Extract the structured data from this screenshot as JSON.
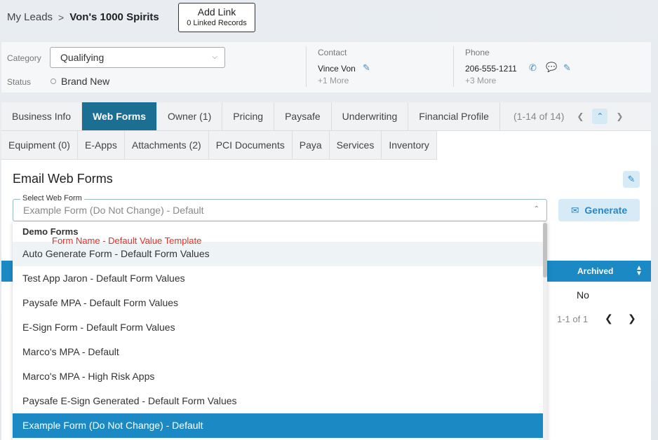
{
  "breadcrumb": {
    "parent": "My Leads",
    "sep": ">",
    "current": "Von's 1000 Spirits"
  },
  "add_link": {
    "label": "Add Link",
    "sub": "0 Linked Records"
  },
  "info": {
    "category_label": "Category",
    "category_value": "Qualifying",
    "status_label": "Status",
    "status_value": "Brand New",
    "contact_label": "Contact",
    "contact_value": "Vince Von",
    "contact_more": "+1 More",
    "phone_label": "Phone",
    "phone_value": "206-555-1211",
    "phone_more": "+3 More"
  },
  "tabs_row1": [
    "Business Info",
    "Web Forms",
    "Owner (1)",
    "Pricing",
    "Paysafe",
    "Underwriting",
    "Financial Profile"
  ],
  "tabs_row2": [
    "Equipment (0)",
    "E-Apps",
    "Attachments (2)",
    "PCI Documents",
    "Paya",
    "Services",
    "Inventory"
  ],
  "active_tab": "Web Forms",
  "tab_pager": "(1-14 of 14)",
  "section_title": "Email Web Forms",
  "web_form_select": {
    "legend": "Select Web Form",
    "value": "Example Form (Do Not Change) - Default"
  },
  "generate_label": "Generate",
  "table": {
    "archived_header": "Archived",
    "archived_value": "No",
    "pager": "1-1 of 1"
  },
  "dropdown": {
    "group": "Demo Forms",
    "annotation": "Form Name  -  Default Value Template",
    "options": [
      "Auto Generate Form - Default Form Values",
      "Test App Jaron - Default Form Values",
      "Paysafe MPA - Default Form Values",
      "E-Sign Form - Default Form Values",
      "Marco's MPA - Default",
      "Marco's MPA - High Risk Apps",
      "Paysafe E-Sign Generated - Default Form Values",
      "Example Form (Do Not Change) - Default"
    ],
    "hovered_index": 0,
    "selected_index": 7
  },
  "colors": {
    "accent": "#1b8ac4",
    "active_tab": "#1b6f92",
    "annotation": "#e0302a"
  }
}
